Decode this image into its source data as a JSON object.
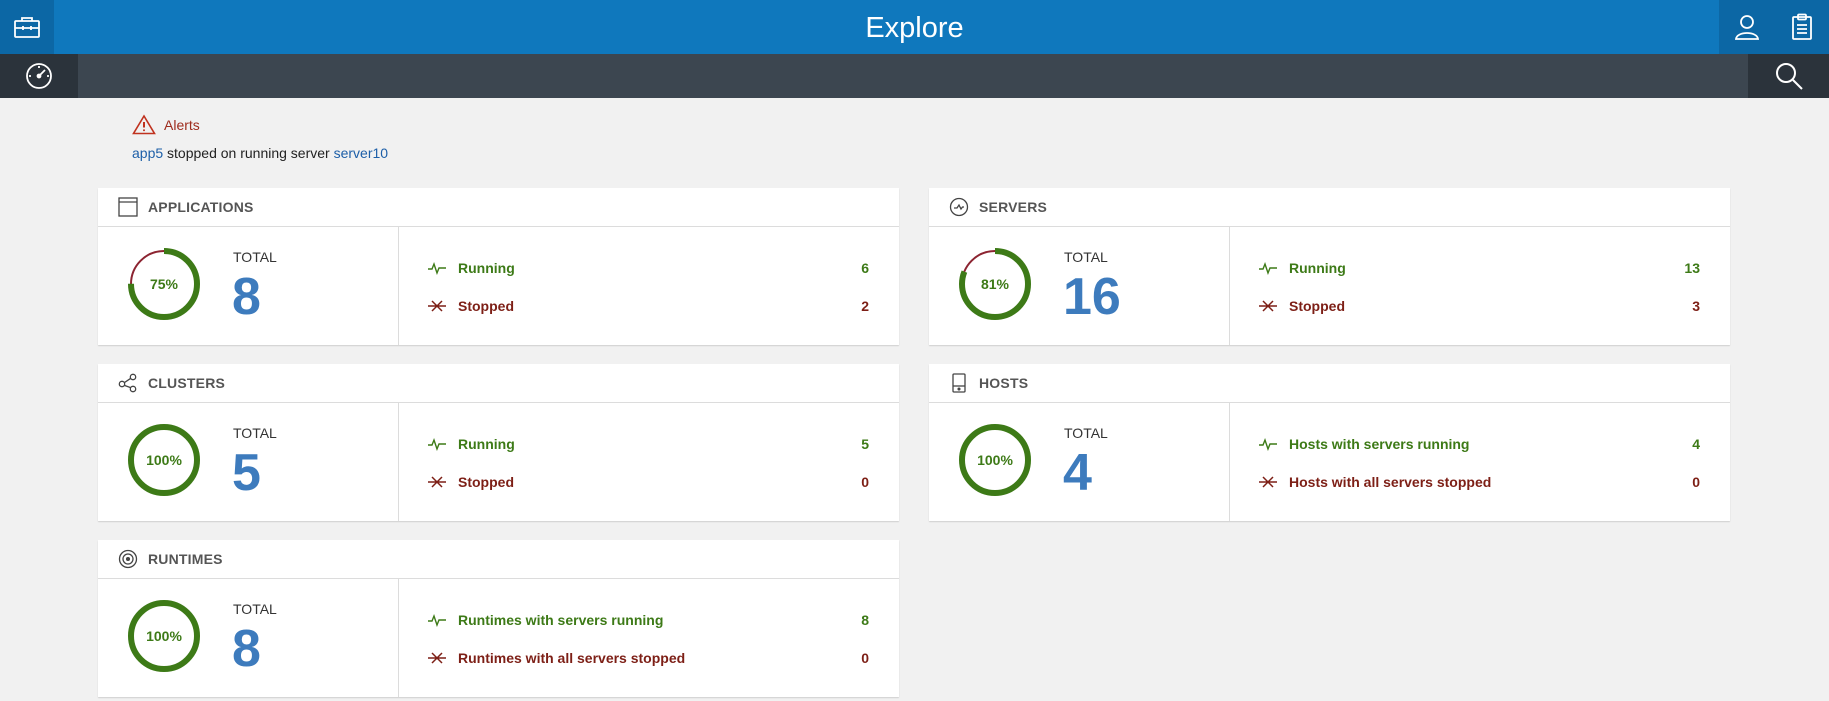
{
  "header": {
    "title": "Explore"
  },
  "alerts": {
    "title": "Alerts",
    "message": {
      "app": "app5",
      "middle": " stopped on running server ",
      "server": "server10"
    }
  },
  "colors": {
    "running": "#3d7a17",
    "stopped": "#7d1f16",
    "ring_track": "#8c2431",
    "total": "#3d7bbd"
  },
  "cards": {
    "applications": {
      "title": "APPLICATIONS",
      "icon": "window-icon",
      "percent_label": "75%",
      "percent": 75,
      "total_label": "TOTAL",
      "total": "8",
      "rows": [
        {
          "label": "Running",
          "count": "6"
        },
        {
          "label": "Stopped",
          "count": "2"
        }
      ]
    },
    "servers": {
      "title": "SERVERS",
      "icon": "server-icon",
      "percent_label": "81%",
      "percent": 81,
      "total_label": "TOTAL",
      "total": "16",
      "rows": [
        {
          "label": "Running",
          "count": "13"
        },
        {
          "label": "Stopped",
          "count": "3"
        }
      ]
    },
    "clusters": {
      "title": "CLUSTERS",
      "icon": "cluster-icon",
      "percent_label": "100%",
      "percent": 100,
      "total_label": "TOTAL",
      "total": "5",
      "rows": [
        {
          "label": "Running",
          "count": "5"
        },
        {
          "label": "Stopped",
          "count": "0"
        }
      ]
    },
    "hosts": {
      "title": "HOSTS",
      "icon": "host-icon",
      "percent_label": "100%",
      "percent": 100,
      "total_label": "TOTAL",
      "total": "4",
      "rows": [
        {
          "label": "Hosts with servers running",
          "count": "4"
        },
        {
          "label": "Hosts with all servers stopped",
          "count": "0"
        }
      ]
    },
    "runtimes": {
      "title": "RUNTIMES",
      "icon": "runtime-icon",
      "percent_label": "100%",
      "percent": 100,
      "total_label": "TOTAL",
      "total": "8",
      "rows": [
        {
          "label": "Runtimes with servers running",
          "count": "8"
        },
        {
          "label": "Runtimes with all servers stopped",
          "count": "0"
        }
      ]
    }
  }
}
